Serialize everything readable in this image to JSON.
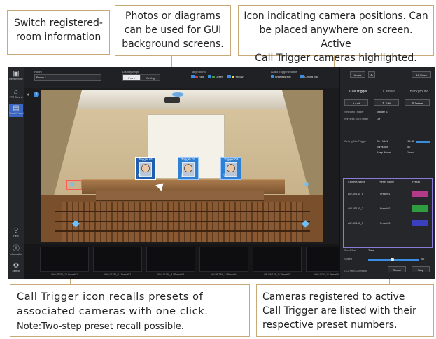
{
  "callouts": {
    "switch_room": [
      "Switch registered-",
      "room information"
    ],
    "photos_bg": [
      "Photos or diagrams",
      "can be used for GUI",
      "background screens."
    ],
    "camera_positions": [
      "Icon indicating camera positions. Can",
      "be placed anywhere on screen. Active",
      "Call Trigger cameras highlighted."
    ],
    "call_trigger": [
      "Call Trigger icon recalls presets of",
      "associated cameras with one click."
    ],
    "call_trigger_note": "Note:Two-step preset recall possible.",
    "cameras_registered": [
      "Cameras registered to active",
      "Call Trigger are listed with their",
      "respective preset numbers."
    ]
  },
  "sidebar": {
    "items": [
      {
        "label": "Device View",
        "icon": "device-view-icon"
      },
      {
        "label": "PTZ Control",
        "icon": "ptz-control-icon"
      },
      {
        "label": "Visual Preset",
        "icon": "visual-preset-icon"
      },
      {
        "label": "Help",
        "icon": "help-icon"
      },
      {
        "label": "Information",
        "icon": "info-icon"
      },
      {
        "label": "Setting",
        "icon": "gear-icon"
      }
    ]
  },
  "topbar": {
    "room_label": "Room",
    "room_value": "Room 1",
    "display_angle_label": "Display Angle",
    "angle_front": "Front",
    "angle_ceiling": "Ceiling",
    "tally_label": "Tally Sound",
    "tally_red": "Red",
    "tally_green": "Green",
    "tally_yellow": "Yellow",
    "audio_label": "Audio Trigger Enable",
    "wireless_mic": "Wireless Mic",
    "ceiling_mic": "Ceiling Mic"
  },
  "scene": {
    "triggers": [
      {
        "label": "Trigger 01",
        "active": true
      },
      {
        "label": "Trigger 02",
        "active": false
      },
      {
        "label": "Trigger 03",
        "active": false
      }
    ],
    "tab_badge": "1"
  },
  "preview": {
    "labels": [
      "AW-UE150_1 / Preset01",
      "AW-UE150_2 / Preset02",
      "AW-UE150_3 / Preset03",
      "AW-HE130_1 / Preset04",
      "AW-UN145_1 / Preset05",
      "AW-UE50_1 / Preset06"
    ]
  },
  "rpanel": {
    "home": "Home",
    "all_close": "All Close",
    "tab_call_trigger": "Call Trigger",
    "tab_camera": "Camera",
    "tab_background": "Background",
    "add": "Add",
    "edit": "Edit",
    "delete": "Delete",
    "rows": [
      {
        "label": "Selected Trigger",
        "value": "Trigger 01"
      },
      {
        "label": "Wireless Mic Trigger",
        "value": "Off"
      },
      {
        "label": "Ceiling Mic Trigger",
        "value": "On / Mic1"
      },
      {
        "label": "Threshold",
        "value": "-15 dB"
      },
      {
        "label": "",
        "value": "50"
      },
      {
        "label": "Keep Wheel",
        "value": "1 sec"
      }
    ],
    "table_headers": [
      "Camera Name",
      "Preset Name",
      "Preset"
    ],
    "table_rows": [
      {
        "camera": "AW-UE150_1",
        "preset": "Preset01",
        "color": "#b33a8a"
      },
      {
        "camera": "AW-UE150_2",
        "preset": "Preset02",
        "color": "#2e9c3f"
      },
      {
        "camera": "AW-UE150_3",
        "preset": "Preset03",
        "color": "#3a3fc0"
      }
    ],
    "scroll_label": "Scroll Bar",
    "scroll_value": "Time",
    "speed_label": "Speed",
    "speed_value": "50",
    "two_step": "2 Step Operation",
    "recall": "Recall",
    "stop": "Stop"
  },
  "colors": {
    "accent": "#3a8de0",
    "leader": "#c8a978",
    "trigger": "#2f7fd3",
    "table_border": "#8a7bd8"
  }
}
